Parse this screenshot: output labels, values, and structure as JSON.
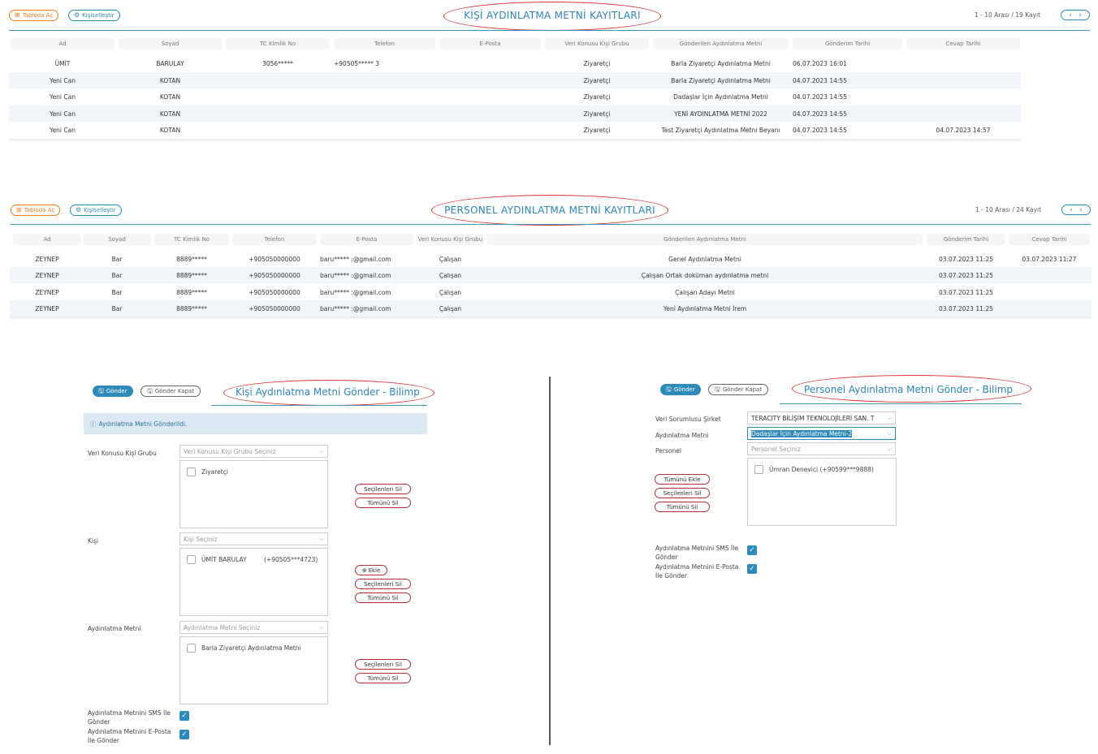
{
  "top": {
    "open_table_label": "Tabloda Aç",
    "customize_label": "Kişiselleştir",
    "title": "KİŞİ AYDINLATMA METNİ KAYITLARI",
    "pager": "1 - 10 Arası  /  19 Kayıt",
    "columns": [
      "Ad",
      "Soyad",
      "TC Kimlik No",
      "Telefon",
      "E-Posta",
      "Veri Konusu Kişi Grubu",
      "Gönderilen Aydınlatma Metni",
      "Gönderim Tarihi",
      "Cevap Tarihi"
    ],
    "rows": [
      [
        "ÜMİT",
        "BARULAY",
        "3056*****",
        "+90505*****  3",
        "",
        "Ziyaretçi",
        "Barla Ziyaretçi Aydınlatma Metni",
        "06.07.2023 16:01",
        ""
      ],
      [
        "Yeni Can",
        "KOTAN",
        "",
        "",
        "",
        "Ziyaretçi",
        "Barla Ziyaretçi Aydınlatma Metni",
        "04.07.2023 14:55",
        ""
      ],
      [
        "Yeni Can",
        "KOTAN",
        "",
        "",
        "",
        "Ziyaretçi",
        "Dadaşlar İçin Aydınlatma Metni",
        "04.07.2023 14:55",
        ""
      ],
      [
        "Yeni Can",
        "KOTAN",
        "",
        "",
        "",
        "Ziyaretçi",
        "YENİ AYDINLATMA METNİ 2022",
        "04.07.2023 14:55",
        ""
      ],
      [
        "Yeni Can",
        "KOTAN",
        "",
        "",
        "",
        "Ziyaretçi",
        "Test Ziyaretçi Aydınlatma Metni Beyanı",
        "04.07.2023 14:55",
        "04.07.2023 14:57"
      ]
    ]
  },
  "middle": {
    "open_table_label": "Tabloda Aç",
    "customize_label": "Kişiselleştir",
    "title": "PERSONEL AYDINLATMA METNİ KAYITLARI",
    "pager": "1 - 10 Arası  /  24 Kayıt",
    "columns": [
      "Ad",
      "Soyad",
      "TC Kimlik No",
      "Telefon",
      "E-Posta",
      "Veri Konusu Kişi Grubu",
      "Gönderilen Aydınlatma Metni",
      "Gönderim Tarihi",
      "Cevap Tarihi"
    ],
    "rows": [
      [
        "ZEYNEP",
        "Bar",
        "8889*****",
        "+905050000000",
        "baru***** :@gmail.com",
        "Çalışan",
        "Genel Aydınlatma Metni",
        "03.07.2023 11:25",
        "03.07.2023 11:27"
      ],
      [
        "ZEYNEP",
        "Bar",
        "8889*****",
        "+905050000000",
        "baru***** :@gmail.com",
        "Çalışan",
        "Çalışan Ortak doküman aydınlatma metni",
        "03.07.2023 11:25",
        ""
      ],
      [
        "ZEYNEP",
        "Bar",
        "8889*****",
        "+905050000000",
        "baru***** :@gmail.com",
        "Çalışan",
        "Çalışan Adayı Metni",
        "03.07.2023 11:25",
        ""
      ],
      [
        "ZEYNEP",
        "Bar",
        "8889*****",
        "+905050000000",
        "baru***** :@gmail.com",
        "Çalışan",
        "Yeni Aydınlatma Metni İrem",
        "03.07.2023 11:25",
        ""
      ]
    ]
  },
  "left_form": {
    "send_label": "Gönder",
    "send_close_label": "Gönder Kapat",
    "title": "Kişi Aydınlatma Metni Gönder - Bilimp",
    "alert": "Aydınlatma Metni Gönderildi.",
    "group_label": "Veri Konusu Kişi Grubu",
    "group_placeholder": "Veri Konusu Kişi Grubu Seçiniz",
    "group_items": [
      "Ziyaretçi"
    ],
    "person_label": "Kişi",
    "person_placeholder": "Kişi Seçiniz",
    "person_name": "ÜMİT BARULAY",
    "person_phone": "(+90505***4723)",
    "text_label": "Aydınlatma Metni",
    "text_placeholder": "Aydınlatma Metni Seçiniz",
    "text_items": [
      "Barla Ziyaretçi Aydınlatma Metni"
    ],
    "add_label": "Ekle",
    "remove_selected_label": "Seçilenleri Sil",
    "remove_all_label": "Tümünü Sil",
    "sms_label": "Aydınlatma Metnini SMS İle Gönder",
    "email_label": "Aydınlatma Metnini E-Posta İle Gönder"
  },
  "right_form": {
    "send_label": "Gönder",
    "send_close_label": "Gönder Kapat",
    "title": "Personel Aydınlatma Metni Gönder - Bilimp",
    "company_label": "Veri Sorumlusu Şirket",
    "company_value": "TERACITY BİLİŞİM TEKNOLOJİLERİ SAN. T",
    "text_label": "Aydınlatma Metni",
    "text_value": "Dadaşlar İçin Aydınlatma Metni-2",
    "personnel_label": "Personel",
    "personnel_placeholder": "Personel Seçiniz",
    "personnel_items": [
      "Ümran Denevici  (+90599***9888)"
    ],
    "add_all_label": "Tümünü Ekle",
    "remove_selected_label": "Seçilenleri Sil",
    "remove_all_label": "Tümünü Sil",
    "sms_label": "Aydınlatma Metnini SMS İle Gönder",
    "email_label": "Aydınlatma Metnini E-Posta İle Gönder"
  }
}
